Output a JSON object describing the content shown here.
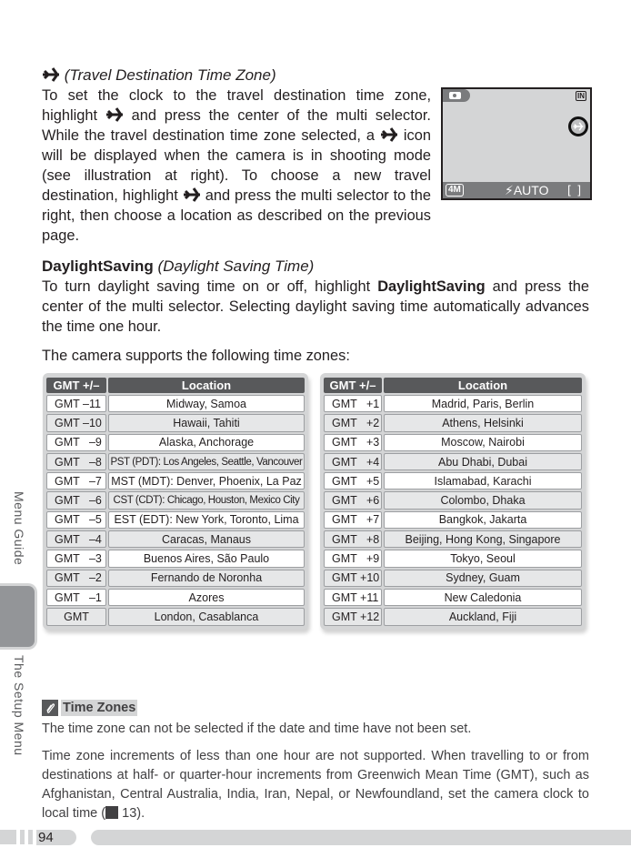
{
  "travel_section": {
    "title": "(Travel Destination Time Zone)",
    "icon": "airplane-icon",
    "p_part1": "To set the clock to the travel destination time zone, highlight ",
    "p_part2": " and press the center of the multi selector. While the travel destination time zone selected, a ",
    "p_part3": " icon will be displayed when the camera is in shooting mode (see illustration at right).  To choose a new travel destination, highlight ",
    "p_part4": " and press the multi selector to the right, then choose a location as described on the previous page."
  },
  "camera_screen": {
    "mode_icon": "camera-icon",
    "memory_badge": "IN",
    "travel_indicator_icon": "airplane-icon",
    "image_size": "4M",
    "flash_symbol": "⚡",
    "flash_mode": "AUTO",
    "focus_brackets": "[   ]"
  },
  "daylight_section": {
    "title_bold": "DaylightSaving",
    "title_italic": " (Daylight Saving Time)",
    "p_part1": "To turn daylight saving time on or off, highlight ",
    "p_bold": "DaylightSaving",
    "p_part2": " and press the center of the multi selector.  Selecting daylight saving time automatically advances the time one hour."
  },
  "supports_text": "The camera supports the following time zones:",
  "timezone_tables": {
    "headers": [
      "GMT +/–",
      "Location"
    ],
    "left": [
      [
        "GMT –11",
        "Midway, Samoa"
      ],
      [
        "GMT –10",
        "Hawaii, Tahiti"
      ],
      [
        "GMT   –9",
        "Alaska, Anchorage"
      ],
      [
        "GMT   –8",
        "PST (PDT): Los Angeles, Seattle, Vancouver"
      ],
      [
        "GMT   –7",
        "MST (MDT): Denver, Phoenix, La Paz"
      ],
      [
        "GMT   –6",
        "CST (CDT): Chicago, Houston, Mexico City"
      ],
      [
        "GMT   –5",
        "EST (EDT): New York, Toronto, Lima"
      ],
      [
        "GMT   –4",
        "Caracas, Manaus"
      ],
      [
        "GMT   –3",
        "Buenos Aires, São Paulo"
      ],
      [
        "GMT   –2",
        "Fernando de Noronha"
      ],
      [
        "GMT   –1",
        "Azores"
      ],
      [
        "GMT",
        "London, Casablanca"
      ]
    ],
    "right": [
      [
        "GMT   +1",
        "Madrid, Paris, Berlin"
      ],
      [
        "GMT   +2",
        "Athens, Helsinki"
      ],
      [
        "GMT   +3",
        "Moscow, Nairobi"
      ],
      [
        "GMT   +4",
        "Abu Dhabi, Dubai"
      ],
      [
        "GMT   +5",
        "Islamabad, Karachi"
      ],
      [
        "GMT   +6",
        "Colombo, Dhaka"
      ],
      [
        "GMT   +7",
        "Bangkok, Jakarta"
      ],
      [
        "GMT   +8",
        "Beijing, Hong Kong, Singapore"
      ],
      [
        "GMT   +9",
        "Tokyo, Seoul"
      ],
      [
        "GMT +10",
        "Sydney, Guam"
      ],
      [
        "GMT +11",
        "New Caledonia"
      ],
      [
        "GMT +12",
        "Auckland, Fiji"
      ]
    ]
  },
  "side_tabs": {
    "upper": "Menu Guide",
    "lower": "The Setup Menu"
  },
  "note": {
    "icon": "pencil-note-icon",
    "title": "Time Zones",
    "p1": "The time zone can not be selected if the date and time have not been set.",
    "p2_part1": "Time zone increments of less than one hour are not supported.  When travelling to or from destinations at half- or quarter-hour increments from Greenwich Mean Time (GMT), such as Afghanistan, Central Australia, India, Iran, Nepal, or Newfoundland, set the camera clock to local time (",
    "ref_icon": "page-reference-icon",
    "ref_page": " 13",
    "p2_part2": ")."
  },
  "footer": {
    "page_number": "94"
  }
}
